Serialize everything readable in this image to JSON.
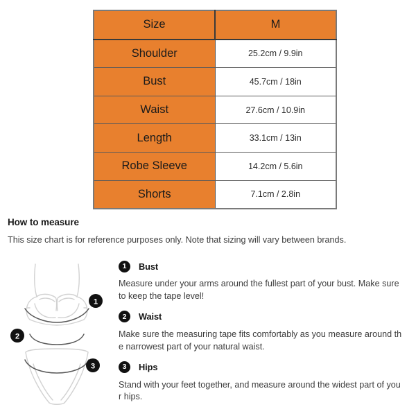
{
  "colors": {
    "accent_orange": "#e8802e",
    "badge_black": "#111111",
    "text_dark": "#222222",
    "text_body": "#3c3c3c",
    "table_border": "#5a5a5a",
    "garment_line": "#d0d0d0",
    "tape_line": "#555555"
  },
  "size_table": {
    "header": {
      "label": "Size",
      "value": "M"
    },
    "rows": [
      {
        "label": "Shoulder",
        "value": "25.2cm / 9.9in"
      },
      {
        "label": "Bust",
        "value": "45.7cm / 18in"
      },
      {
        "label": "Waist",
        "value": "27.6cm / 10.9in"
      },
      {
        "label": "Length",
        "value": "33.1cm / 13in"
      },
      {
        "label": "Robe Sleeve",
        "value": "14.2cm / 5.6in"
      },
      {
        "label": "Shorts",
        "value": "7.1cm / 2.8in"
      }
    ]
  },
  "how_to_measure": {
    "heading": "How to measure",
    "note": "This size chart is for reference purposes only. Note that sizing will vary between brands.",
    "items": [
      {
        "number": "1",
        "title": "Bust",
        "text": "Measure under your arms around the fullest part of your bust. Make sure to keep the tape level!"
      },
      {
        "number": "2",
        "title": "Waist",
        "text": "Make sure the measuring tape fits comfortably as you measure around the narrowest part of your natural waist."
      },
      {
        "number": "3",
        "title": "Hips",
        "text": "Stand with your feet together, and measure around the widest part of your hips."
      }
    ]
  },
  "illustration": {
    "markers": [
      {
        "number": "1",
        "measures": "bust"
      },
      {
        "number": "2",
        "measures": "waist"
      },
      {
        "number": "3",
        "measures": "hips"
      }
    ]
  }
}
